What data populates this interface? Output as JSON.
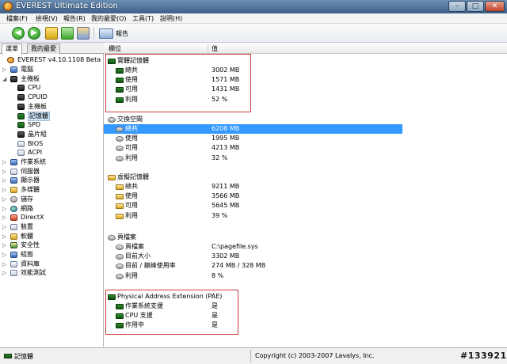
{
  "window": {
    "title": "EVEREST Ultimate Edition",
    "min_glyph": "–",
    "max_glyph": "□",
    "close_glyph": "✕"
  },
  "menu": [
    "檔案(F)",
    "檢視(V)",
    "報告(R)",
    "我的最愛(O)",
    "工具(T)",
    "說明(H)"
  ],
  "toolbar": {
    "back_glyph": "◀",
    "forward_glyph": "▶",
    "report_label": "報告"
  },
  "left": {
    "tabs": [
      "選單",
      "我的最愛"
    ],
    "root": "EVEREST v4.10.1108 Beta",
    "tree": [
      {
        "label": "電腦",
        "icon": "computer-icon",
        "expander": "▷"
      },
      {
        "label": "主機板",
        "icon": "motherboard-icon",
        "expander": "◢"
      },
      {
        "label": "CPU",
        "icon": "cpu-icon",
        "expander": ""
      },
      {
        "label": "CPUID",
        "icon": "cpuid-icon",
        "expander": ""
      },
      {
        "label": "主機板",
        "icon": "motherboard-icon",
        "expander": ""
      },
      {
        "label": "記憶體",
        "icon": "memory-icon",
        "expander": "",
        "selected": true
      },
      {
        "label": "SPD",
        "icon": "spd-icon",
        "expander": ""
      },
      {
        "label": "晶片組",
        "icon": "chipset-icon",
        "expander": ""
      },
      {
        "label": "BIOS",
        "icon": "bios-icon",
        "expander": ""
      },
      {
        "label": "ACPI",
        "icon": "acpi-icon",
        "expander": ""
      },
      {
        "label": "作業系統",
        "icon": "os-icon",
        "expander": "▷"
      },
      {
        "label": "伺服器",
        "icon": "server-icon",
        "expander": "▷"
      },
      {
        "label": "顯示器",
        "icon": "display-icon",
        "expander": "▷"
      },
      {
        "label": "多媒體",
        "icon": "multimedia-icon",
        "expander": "▷"
      },
      {
        "label": "儲存",
        "icon": "storage-icon",
        "expander": "▷"
      },
      {
        "label": "網路",
        "icon": "network-icon",
        "expander": "▷"
      },
      {
        "label": "DirectX",
        "icon": "directx-icon",
        "expander": "▷"
      },
      {
        "label": "裝置",
        "icon": "devices-icon",
        "expander": "▷"
      },
      {
        "label": "軟體",
        "icon": "software-icon",
        "expander": "▷"
      },
      {
        "label": "安全性",
        "icon": "security-icon",
        "expander": "▷"
      },
      {
        "label": "組態",
        "icon": "config-icon",
        "expander": "▷"
      },
      {
        "label": "資料庫",
        "icon": "database-icon",
        "expander": "▷"
      },
      {
        "label": "效能測試",
        "icon": "benchmark-icon",
        "expander": "▷"
      }
    ]
  },
  "right": {
    "columns": {
      "field": "欄位",
      "value": "值"
    },
    "sections": [
      {
        "title": "實體記憶體",
        "icon": "ram-icon",
        "rows": [
          {
            "field": "總共",
            "value": "3002 MB"
          },
          {
            "field": "使用",
            "value": "1571 MB"
          },
          {
            "field": "可用",
            "value": "1431 MB"
          },
          {
            "field": "利用",
            "value": "52 %"
          }
        ]
      },
      {
        "title": "交換空間",
        "icon": "disk-icon",
        "rows": [
          {
            "field": "總共",
            "value": "6208 MB",
            "selected": true
          },
          {
            "field": "使用",
            "value": "1995 MB"
          },
          {
            "field": "可用",
            "value": "4213 MB"
          },
          {
            "field": "利用",
            "value": "32 %"
          }
        ]
      },
      {
        "title": "虛擬記憶體",
        "icon": "folder-icon",
        "rows": [
          {
            "field": "總共",
            "value": "9211 MB"
          },
          {
            "field": "使用",
            "value": "3566 MB"
          },
          {
            "field": "可用",
            "value": "5645 MB"
          },
          {
            "field": "利用",
            "value": "39 %"
          }
        ]
      },
      {
        "title": "頁檔案",
        "icon": "disk-icon",
        "rows": [
          {
            "field": "頁檔案",
            "value": "C:\\pagefile.sys"
          },
          {
            "field": "目前大小",
            "value": "3302 MB"
          },
          {
            "field": "目前 / 巔峰使用率",
            "value": "274 MB / 328 MB"
          },
          {
            "field": "利用",
            "value": "8 %"
          }
        ]
      },
      {
        "title": "Physical Address Extension (PAE)",
        "icon": "ram-icon",
        "rows": [
          {
            "field": "作業系統支援",
            "value": "是"
          },
          {
            "field": "CPU 支援",
            "value": "是"
          },
          {
            "field": "作用中",
            "value": "是"
          }
        ]
      }
    ]
  },
  "status": {
    "left": "記憶體",
    "right": "Copyright (c) 2003-2007 Lavalys, Inc."
  },
  "watermark": "#133921"
}
